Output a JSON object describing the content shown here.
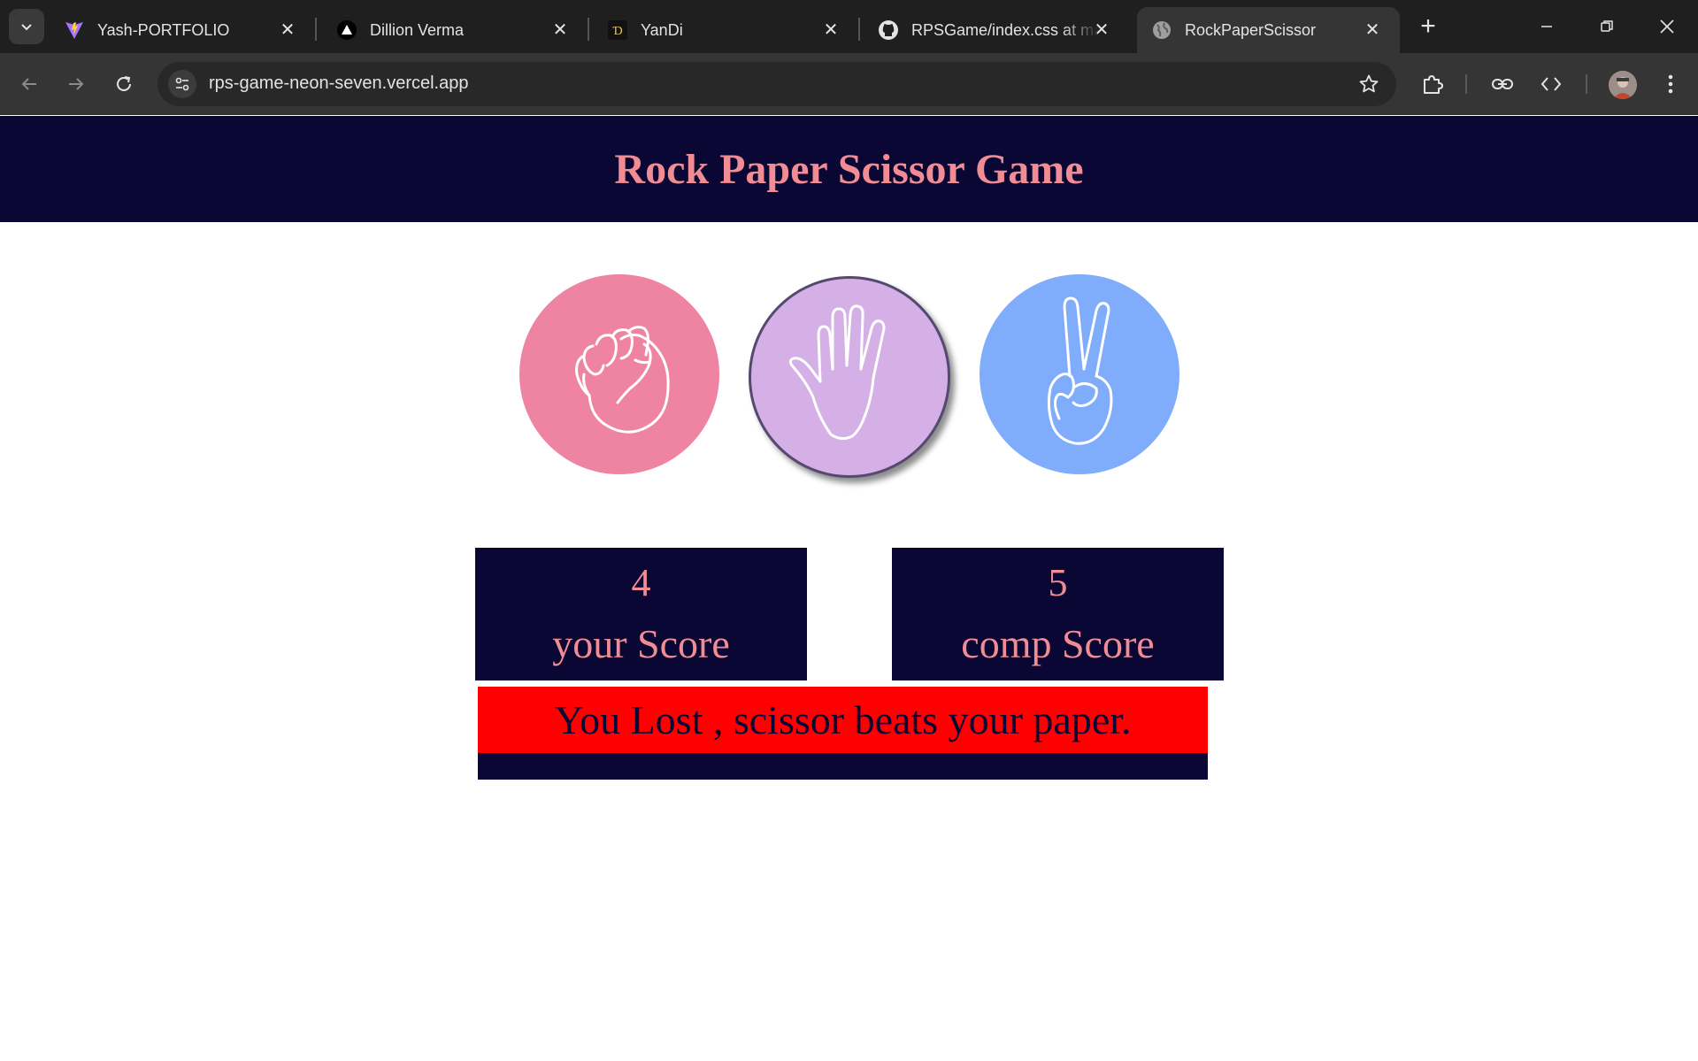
{
  "browser": {
    "tabs": [
      {
        "title": "Yash-PORTFOLIO",
        "icon": "vite-logo-icon"
      },
      {
        "title": "Dillion Verma",
        "icon": "triangle-logo-icon"
      },
      {
        "title": "YanDi",
        "icon": "yandi-logo-icon"
      },
      {
        "title": "RPSGame/index.css at main",
        "icon": "github-icon"
      },
      {
        "title": "RockPaperScissor",
        "icon": "globe-icon",
        "active": true
      }
    ],
    "url": "rps-game-neon-seven.vercel.app"
  },
  "page": {
    "title": "Rock Paper Scissor Game",
    "choices": [
      {
        "id": "rock",
        "icon": "rock-fist-icon",
        "color": "#ef84a2"
      },
      {
        "id": "paper",
        "icon": "paper-hand-icon",
        "color": "#d4b0e6",
        "selected": true
      },
      {
        "id": "scissor",
        "icon": "scissor-peace-icon",
        "color": "#80adfb"
      }
    ],
    "scores": {
      "user": {
        "value": "4",
        "label": "your Score"
      },
      "comp": {
        "value": "5",
        "label": "comp Score"
      }
    },
    "message": "You Lost , scissor beats your paper."
  },
  "colors": {
    "header_bg": "#0b0735",
    "accent_text": "#f28c94",
    "message_bg": "#ff0000"
  }
}
